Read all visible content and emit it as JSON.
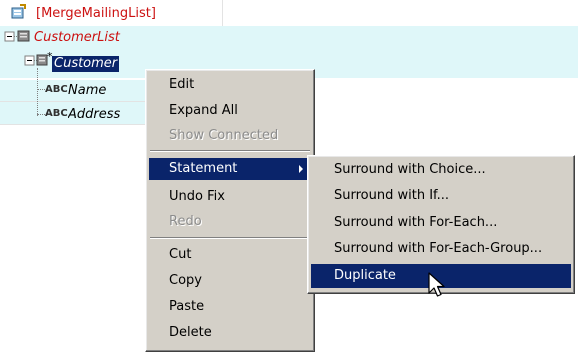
{
  "tree": {
    "root_label": "[MergeMailingList]",
    "customer_list_label": "CustomerList",
    "customer_marker": "*",
    "customer_label": "Customer",
    "name_label": "Name",
    "address_label": "Address",
    "text_icon_label": "ABC"
  },
  "context_menu": {
    "items": [
      {
        "label": "Edit",
        "enabled": true
      },
      {
        "label": "Expand All",
        "enabled": true
      },
      {
        "label": "Show Connected",
        "enabled": false
      },
      {
        "label": "Statement",
        "enabled": true,
        "highlighted": true,
        "has_submenu": true
      },
      {
        "label": "Undo Fix",
        "enabled": true
      },
      {
        "label": "Redo",
        "enabled": false
      },
      {
        "label": "Cut",
        "enabled": true
      },
      {
        "label": "Copy",
        "enabled": true
      },
      {
        "label": "Paste",
        "enabled": true
      },
      {
        "label": "Delete",
        "enabled": true
      }
    ]
  },
  "statement_submenu": {
    "items": [
      {
        "label": "Surround with Choice..."
      },
      {
        "label": "Surround with If..."
      },
      {
        "label": "Surround with For-Each..."
      },
      {
        "label": "Surround with For-Each-Group..."
      },
      {
        "label": "Duplicate",
        "highlighted": true
      }
    ]
  },
  "colors": {
    "menu_bg": "#d4d0c8",
    "highlight": "#0a246a",
    "tree_red": "#cc1111",
    "row_band": "#dff7f9"
  }
}
